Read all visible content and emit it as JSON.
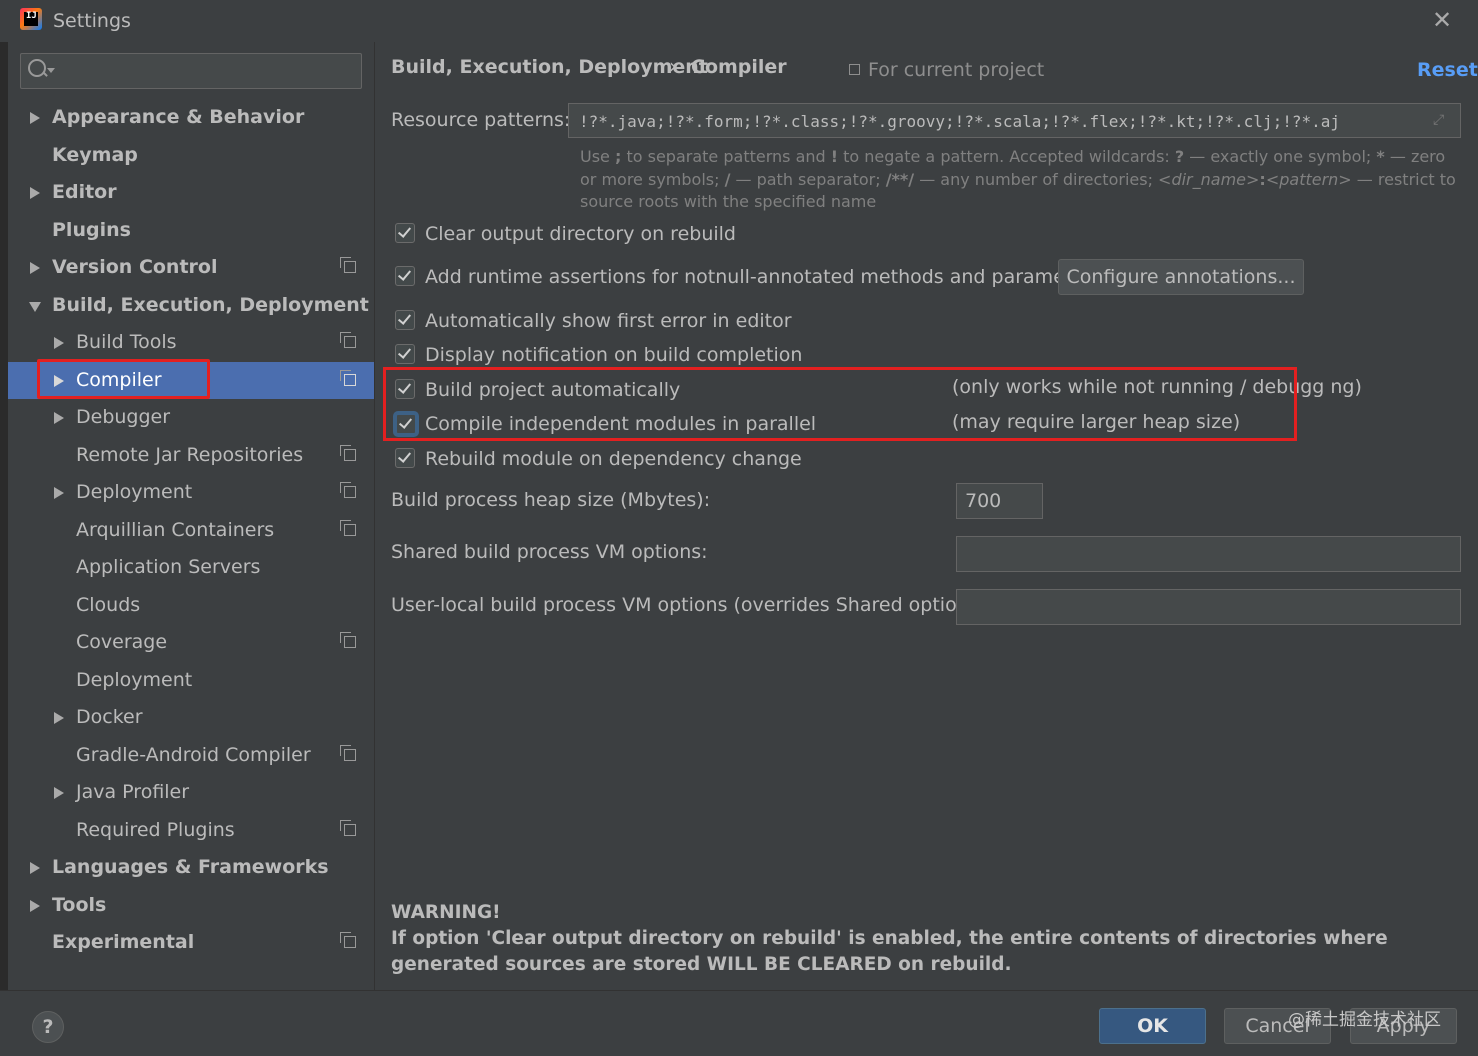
{
  "window": {
    "title": "Settings",
    "app_icon_text": "IJ"
  },
  "sidebar": {
    "search_placeholder": "",
    "items": [
      {
        "label": "Appearance & Behavior"
      },
      {
        "label": "Keymap"
      },
      {
        "label": "Editor"
      },
      {
        "label": "Plugins"
      },
      {
        "label": "Version Control"
      },
      {
        "label": "Build, Execution, Deployment"
      },
      {
        "label": "Build Tools"
      },
      {
        "label": "Compiler"
      },
      {
        "label": "Debugger"
      },
      {
        "label": "Remote Jar Repositories"
      },
      {
        "label": "Deployment"
      },
      {
        "label": "Arquillian Containers"
      },
      {
        "label": "Application Servers"
      },
      {
        "label": "Clouds"
      },
      {
        "label": "Coverage"
      },
      {
        "label": "Deployment"
      },
      {
        "label": "Docker"
      },
      {
        "label": "Gradle-Android Compiler"
      },
      {
        "label": "Java Profiler"
      },
      {
        "label": "Required Plugins"
      },
      {
        "label": "Languages & Frameworks"
      },
      {
        "label": "Tools"
      },
      {
        "label": "Experimental"
      }
    ]
  },
  "header": {
    "breadcrumb_parent": "Build, Execution, Deployment",
    "breadcrumb_separator": "›",
    "breadcrumb_current": "Compiler",
    "scope_label": "For current project",
    "reset_label": "Reset"
  },
  "compiler": {
    "resource_patterns_label": "Resource patterns:",
    "resource_patterns_value": "!?*.java;!?*.form;!?*.class;!?*.groovy;!?*.scala;!?*.flex;!?*.kt;!?*.clj;!?*.aj",
    "hint": {
      "p1": "Use ",
      "sep": ";",
      "p2": " to separate patterns and ",
      "neg": "!",
      "p3": " to negate a pattern. Accepted wildcards: ",
      "q": "?",
      "p4": " — exactly one symbol; ",
      "star": "*",
      "p5": " — zero or more symbols; ",
      "slash": "/",
      "p6": " — path separator; ",
      "dstar": "/**/",
      "p7": " — any number of directories; ",
      "dir": "<dir_name>",
      "colon": ":",
      "pat": "<pattern>",
      "p8": " — restrict to source roots with the specified name"
    },
    "options": [
      {
        "label": "Clear output directory on rebuild",
        "checked": true
      },
      {
        "label": "Add runtime assertions for notnull-annotated methods and parameters",
        "checked": true
      },
      {
        "label": "Automatically show first error in editor",
        "checked": true
      },
      {
        "label": "Display notification on build completion",
        "checked": true
      },
      {
        "label": "Build project automatically",
        "checked": true
      },
      {
        "label": "Compile independent modules in parallel",
        "checked": true
      },
      {
        "label": "Rebuild module on dependency change",
        "checked": true
      }
    ],
    "configure_annotations_label": "Configure annotations...",
    "note_build_auto": "(only works while not running / debugg ng)",
    "note_parallel": "(may require larger heap size)",
    "heap_label": "Build process heap size (Mbytes):",
    "heap_value": "700",
    "shared_vm_label": "Shared build process VM options:",
    "shared_vm_value": "",
    "user_vm_label": "User-local build process VM options (overrides Shared options):",
    "user_vm_value": "",
    "warning_title": "WARNING!",
    "warning_text": "If option 'Clear output directory on rebuild' is enabled, the entire contents of directories where generated sources are stored WILL BE CLEARED on rebuild."
  },
  "footer": {
    "help_label": "?",
    "ok_label": "OK",
    "cancel_label": "Cancel",
    "apply_label": "Apply",
    "watermark": "@稀土掘金技术社区"
  },
  "colors": {
    "background": "#3c3f41",
    "selection": "#4b6eaf",
    "link": "#589df6",
    "highlight_box": "#e32020",
    "ok_button": "#365880"
  }
}
